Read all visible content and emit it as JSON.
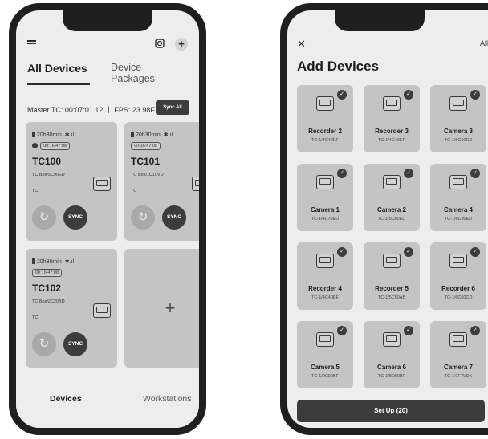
{
  "left": {
    "tabs": {
      "all_devices": "All Devices",
      "device_packages": "Device Packages"
    },
    "master": {
      "text": "Master TC: 00:07:01.12 丨 FPS: 23.98F",
      "sync_all": "Sync All"
    },
    "devices": [
      {
        "status": "20h30min",
        "signal": "✱.ıl",
        "timecode": "00:16:47:08",
        "name": "TC100",
        "box": "TC Box/5C90ED",
        "tc": "TC",
        "sync": "SYNC",
        "refresh_glyph": "↻"
      },
      {
        "status": "20h30min",
        "signal": "✱.ıl",
        "timecode": "00:16:47:08",
        "name": "TC101",
        "box": "TC Box/1C10VD",
        "tc": "TC",
        "sync": "SYNC",
        "refresh_glyph": "↻"
      },
      {
        "status": "20h30min",
        "signal": "✱.ıl",
        "timecode": "00:16:47:08",
        "name": "TC102",
        "box": "TC Box/2C20BD",
        "tc": "TC",
        "sync": "SYNC",
        "refresh_glyph": "↻"
      }
    ],
    "add_glyph": "+",
    "plus_glyph": "+",
    "nav": {
      "devices": "Devices",
      "workstations": "Workstations"
    }
  },
  "right": {
    "close_glyph": "✕",
    "all": "All",
    "title": "Add Devices",
    "check_glyph": "✓",
    "cameras": [
      {
        "name": "Recorder 2",
        "id": "TC-1/4C40EF"
      },
      {
        "name": "Recorder 3",
        "id": "TC-1/4C40EF"
      },
      {
        "name": "Camera 3",
        "id": "TC-1/6C60CD"
      },
      {
        "name": "Camera 1",
        "id": "TC-1/4C70ED"
      },
      {
        "name": "Camera 2",
        "id": "TC-1/5C80ED"
      },
      {
        "name": "Camera 4",
        "id": "TC-1/6C90ED"
      },
      {
        "name": "Recorder 4",
        "id": "TC-1/4C40EF"
      },
      {
        "name": "Recorder 5",
        "id": "TC-1/5C50AB"
      },
      {
        "name": "Recorder 6",
        "id": "TC-1/6C60CD"
      },
      {
        "name": "Camera 5",
        "id": "TC-1/9C90BF"
      },
      {
        "name": "Camera 6",
        "id": "TC-1/8D80BF"
      },
      {
        "name": "Camera 7",
        "id": "TC-1/7F7VDK"
      }
    ],
    "setup": "Set Up (20)"
  }
}
